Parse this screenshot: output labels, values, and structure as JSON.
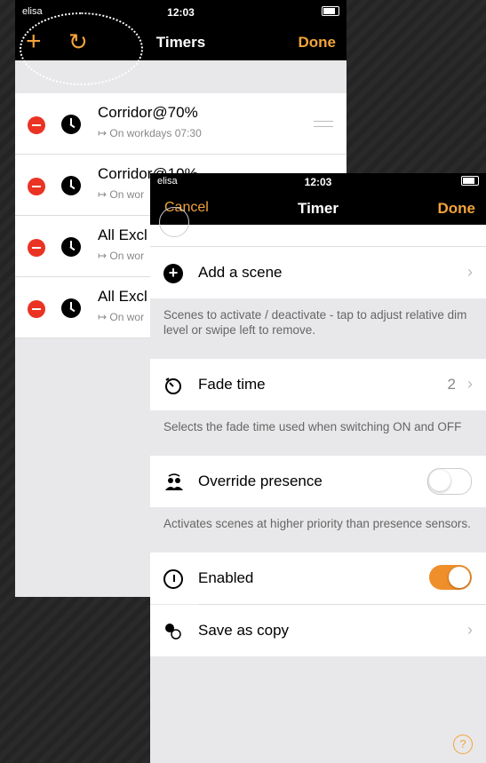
{
  "back_screen": {
    "status": {
      "carrier": "elisa",
      "time": "12:03"
    },
    "nav": {
      "title": "Timers",
      "done_label": "Done",
      "add_icon": "+",
      "refresh_icon": "↻"
    },
    "timers": [
      {
        "name": "Corridor@70%",
        "schedule": "↦ On workdays 07:30"
      },
      {
        "name": "Corridor@10%",
        "schedule": "↦ On wor"
      },
      {
        "name": "All Excl",
        "schedule": "↦ On wor"
      },
      {
        "name": "All Excl",
        "schedule": "↦ On wor"
      }
    ]
  },
  "front_screen": {
    "status": {
      "carrier": "elisa",
      "time": "12:03"
    },
    "nav": {
      "cancel_label": "Cancel",
      "title": "Timer",
      "done_label": "Done"
    },
    "add_scene": {
      "label": "Add a scene",
      "note": "Scenes to activate / deactivate - tap to adjust relative dim level or swipe left to remove."
    },
    "fade_time": {
      "label": "Fade time",
      "value": "2",
      "note": "Selects the fade time used when switching ON and OFF"
    },
    "override_presence": {
      "label": "Override presence",
      "enabled": false,
      "note": "Activates scenes at higher priority than presence sensors."
    },
    "enabled": {
      "label": "Enabled",
      "enabled": true
    },
    "save_copy": {
      "label": "Save as copy"
    },
    "help_icon": "?",
    "chevron": "›"
  },
  "colors": {
    "accent": "#f2a33a",
    "toggle_on": "#ef8f2c",
    "delete": "#ea3323"
  }
}
